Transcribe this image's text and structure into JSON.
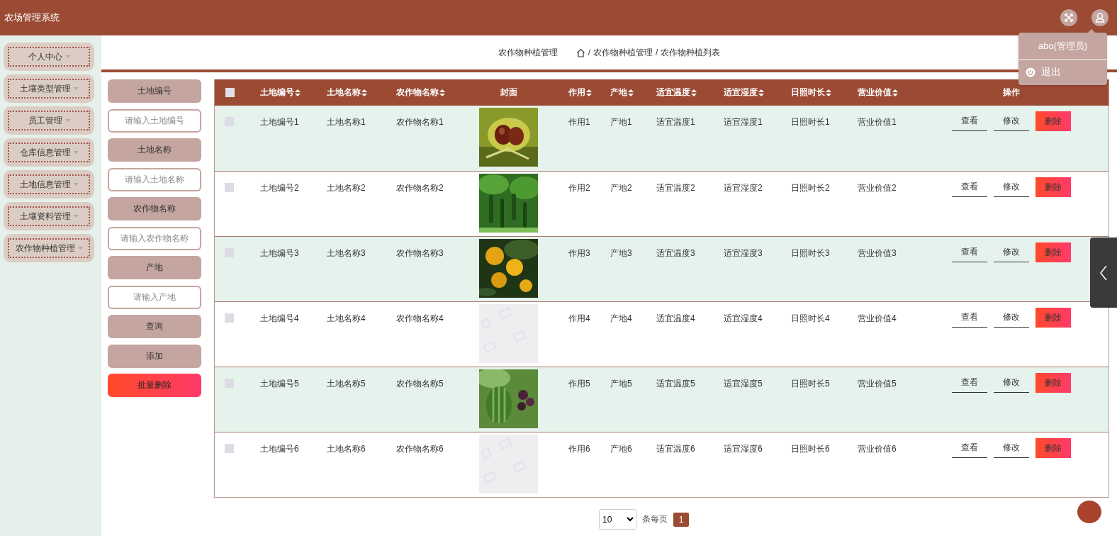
{
  "header": {
    "title": "农场管理系统"
  },
  "user_menu": {
    "user": "abo(管理员)",
    "items": [
      {
        "label": "退出",
        "kind": "logout"
      }
    ]
  },
  "sidebar": {
    "items": [
      {
        "label": "个人中心"
      },
      {
        "label": "土壤类型管理"
      },
      {
        "label": "员工管理"
      },
      {
        "label": "仓库信息管理"
      },
      {
        "label": "土地信息管理"
      },
      {
        "label": "土壤资料管理"
      },
      {
        "label": "农作物种植管理"
      }
    ]
  },
  "breadcrumb": {
    "page_title": "农作物种植管理",
    "path": [
      {
        "separator": "/",
        "label": "农作物种植管理"
      },
      {
        "separator": "/",
        "label": "农作物种植列表"
      }
    ]
  },
  "search": {
    "fields": [
      {
        "label": "土地编号",
        "placeholder": "请输入土地编号"
      },
      {
        "label": "土地名称",
        "placeholder": "请输入土地名称"
      },
      {
        "label": "农作物名称",
        "placeholder": "请输入农作物名称"
      },
      {
        "label": "产地",
        "placeholder": "请输入产地"
      }
    ],
    "buttons": [
      {
        "label": "查询",
        "kind": "normal"
      },
      {
        "label": "添加",
        "kind": "normal"
      },
      {
        "label": "批量删除",
        "kind": "danger"
      }
    ]
  },
  "table": {
    "all_checked": false,
    "columns": [
      {
        "label": "土地编号",
        "sortable": true
      },
      {
        "label": "土地名称",
        "sortable": true
      },
      {
        "label": "农作物名称",
        "sortable": true
      },
      {
        "label": "封面",
        "sortable": false
      },
      {
        "label": "作用",
        "sortable": true
      },
      {
        "label": "产地",
        "sortable": true
      },
      {
        "label": "适宜温度",
        "sortable": true
      },
      {
        "label": "适宜湿度",
        "sortable": true
      },
      {
        "label": "日照时长",
        "sortable": true
      },
      {
        "label": "营业价值",
        "sortable": true
      },
      {
        "label": "操作",
        "sortable": false
      }
    ],
    "rows": [
      {
        "checked": false,
        "cells": [
          "土地编号1",
          "土地名称1",
          "农作物名称1"
        ],
        "cover": {
          "kind": "picture"
        },
        "cells2": [
          "作用1",
          "产地1",
          "适宜温度1",
          "适宜湿度1",
          "日照时长1",
          "营业价值1"
        ],
        "actions": [
          {
            "label": "查看",
            "kind": "link"
          },
          {
            "label": "修改",
            "kind": "link"
          },
          {
            "label": "删除",
            "kind": "danger"
          }
        ]
      },
      {
        "checked": false,
        "cells": [
          "土地编号2",
          "土地名称2",
          "农作物名称2"
        ],
        "cover": {
          "kind": "picture"
        },
        "cells2": [
          "作用2",
          "产地2",
          "适宜温度2",
          "适宜湿度2",
          "日照时长2",
          "营业价值2"
        ],
        "actions": [
          {
            "label": "查看",
            "kind": "link"
          },
          {
            "label": "修改",
            "kind": "link"
          },
          {
            "label": "删除",
            "kind": "danger"
          }
        ]
      },
      {
        "checked": false,
        "cells": [
          "土地编号3",
          "土地名称3",
          "农作物名称3"
        ],
        "cover": {
          "kind": "picture"
        },
        "cells2": [
          "作用3",
          "产地3",
          "适宜温度3",
          "适宜湿度3",
          "日照时长3",
          "营业价值3"
        ],
        "actions": [
          {
            "label": "查看",
            "kind": "link"
          },
          {
            "label": "修改",
            "kind": "link"
          },
          {
            "label": "删除",
            "kind": "danger"
          }
        ]
      },
      {
        "checked": false,
        "cells": [
          "土地编号4",
          "土地名称4",
          "农作物名称4"
        ],
        "cover": {
          "kind": "placeholder"
        },
        "cells2": [
          "作用4",
          "产地4",
          "适宜温度4",
          "适宜湿度4",
          "日照时长4",
          "营业价值4"
        ],
        "actions": [
          {
            "label": "查看",
            "kind": "link"
          },
          {
            "label": "修改",
            "kind": "link"
          },
          {
            "label": "删除",
            "kind": "danger"
          }
        ]
      },
      {
        "checked": false,
        "cells": [
          "土地编号5",
          "土地名称5",
          "农作物名称5"
        ],
        "cover": {
          "kind": "picture"
        },
        "cells2": [
          "作用5",
          "产地5",
          "适宜温度5",
          "适宜湿度5",
          "日照时长5",
          "营业价值5"
        ],
        "actions": [
          {
            "label": "查看",
            "kind": "link"
          },
          {
            "label": "修改",
            "kind": "link"
          },
          {
            "label": "删除",
            "kind": "danger"
          }
        ]
      },
      {
        "checked": false,
        "cells": [
          "土地编号6",
          "土地名称6",
          "农作物名称6"
        ],
        "cover": {
          "kind": "placeholder"
        },
        "cells2": [
          "作用6",
          "产地6",
          "适宜温度6",
          "适宜湿度6",
          "日照时长6",
          "营业价值6"
        ],
        "actions": [
          {
            "label": "查看",
            "kind": "link"
          },
          {
            "label": "修改",
            "kind": "link"
          },
          {
            "label": "删除",
            "kind": "danger"
          }
        ]
      }
    ]
  },
  "pagination": {
    "page_size": "10",
    "per_page_label": "条每页",
    "pages": [
      {
        "label": "1",
        "selected": true
      }
    ]
  }
}
